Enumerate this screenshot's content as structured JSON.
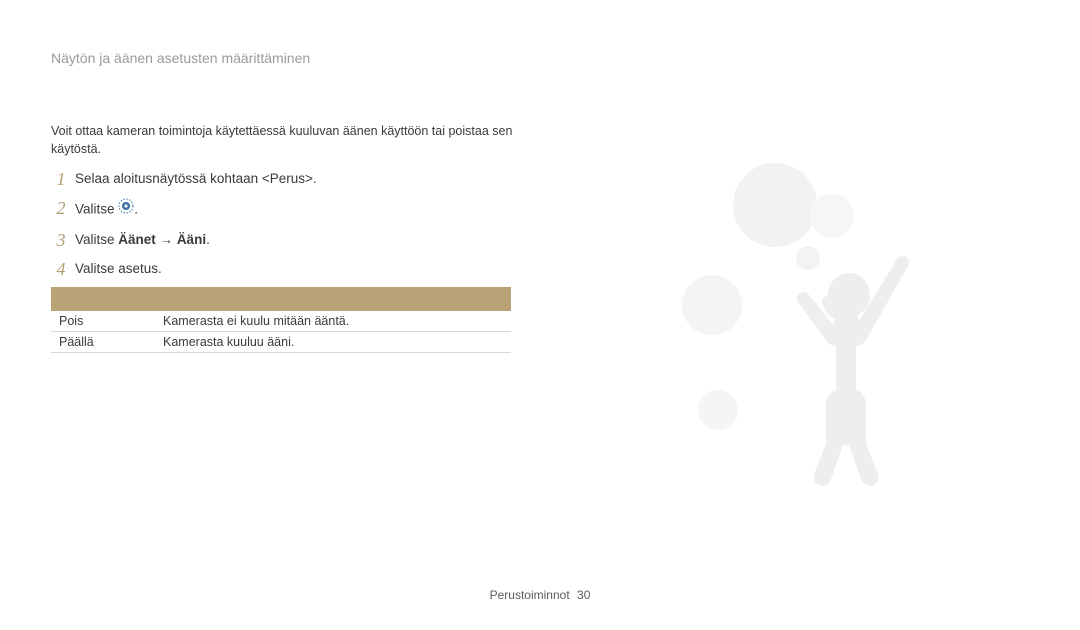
{
  "header": {
    "title": "Näytön ja äänen asetusten määrittäminen"
  },
  "intro": "Voit ottaa kameran toimintoja käytettäessä kuuluvan äänen käyttöön tai poistaa sen käytöstä.",
  "steps": {
    "s1": {
      "num": "1",
      "text_a": "Selaa aloitusnäytössä kohtaan ",
      "text_b": "<Perus>",
      "text_c": "."
    },
    "s2": {
      "num": "2",
      "text_a": "Valitse ",
      "text_b": "."
    },
    "s3": {
      "num": "3",
      "text_a": "Valitse ",
      "b": "Äänet",
      "arrow": " → ",
      "c": "Ääni",
      "text_d": "."
    },
    "s4": {
      "num": "4",
      "text_a": "Valitse asetus."
    }
  },
  "table": {
    "rows": [
      {
        "c1": "Pois",
        "c2": "Kamerasta ei kuulu mitään ääntä."
      },
      {
        "c1": "Päällä",
        "c2": "Kamerasta kuuluu ääni."
      }
    ]
  },
  "footer": {
    "section": "Perustoiminnot",
    "page": "30"
  }
}
